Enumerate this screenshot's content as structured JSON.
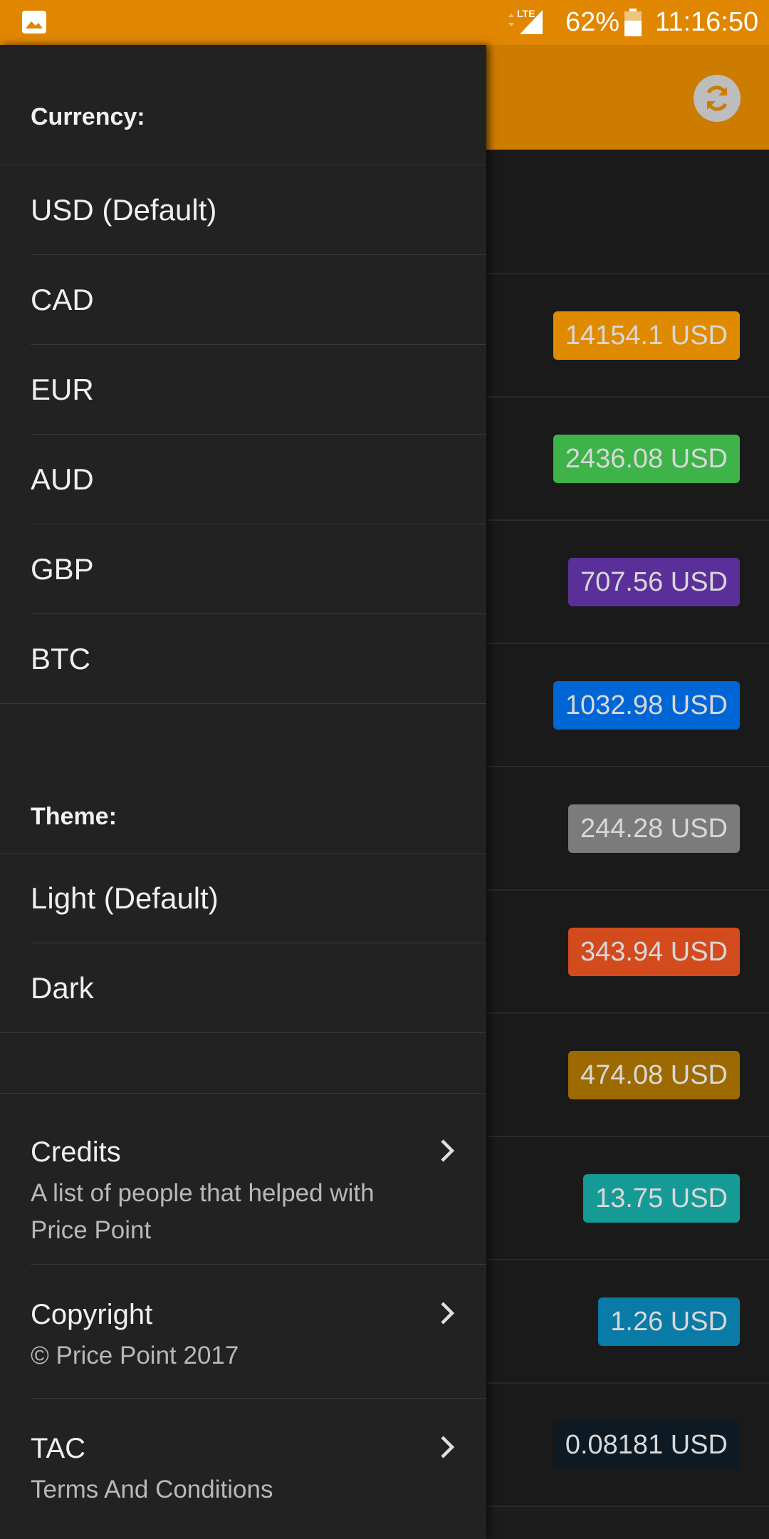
{
  "status_bar": {
    "network": "LTE",
    "battery": "62%",
    "time": "11:16:50"
  },
  "background_list": {
    "prices": [
      {
        "text": "14154.1 USD",
        "color": "#e08a00"
      },
      {
        "text": "2436.08 USD",
        "color": "#3db34a"
      },
      {
        "text": "707.56 USD",
        "color": "#5b2f9a"
      },
      {
        "text": "1032.98 USD",
        "color": "#0066d6"
      },
      {
        "text": "244.28 USD",
        "color": "#7b7b7b"
      },
      {
        "text": "343.94 USD",
        "color": "#d34b1d"
      },
      {
        "text": "474.08 USD",
        "color": "#9c6a00"
      },
      {
        "text": "13.75 USD",
        "color": "#159a96"
      },
      {
        "text": "1.26 USD",
        "color": "#0a7aa6"
      },
      {
        "text": "0.08181 USD",
        "color": "#0d1a24"
      }
    ]
  },
  "drawer": {
    "currency_header": "Currency:",
    "currencies": [
      "USD (Default)",
      "CAD",
      "EUR",
      "AUD",
      "GBP",
      "BTC"
    ],
    "theme_header": "Theme:",
    "themes": [
      "Light (Default)",
      "Dark"
    ],
    "links": {
      "credits": {
        "title": "Credits",
        "subtitle": "A list of people that helped with Price Point"
      },
      "copyright": {
        "title": "Copyright",
        "subtitle": "© Price Point 2017"
      },
      "tac": {
        "title": "TAC",
        "subtitle": "Terms And Conditions"
      }
    }
  },
  "colors": {
    "status_bar": "#e08600",
    "app_bar": "#cc7c00",
    "drawer_bg": "#222222"
  }
}
